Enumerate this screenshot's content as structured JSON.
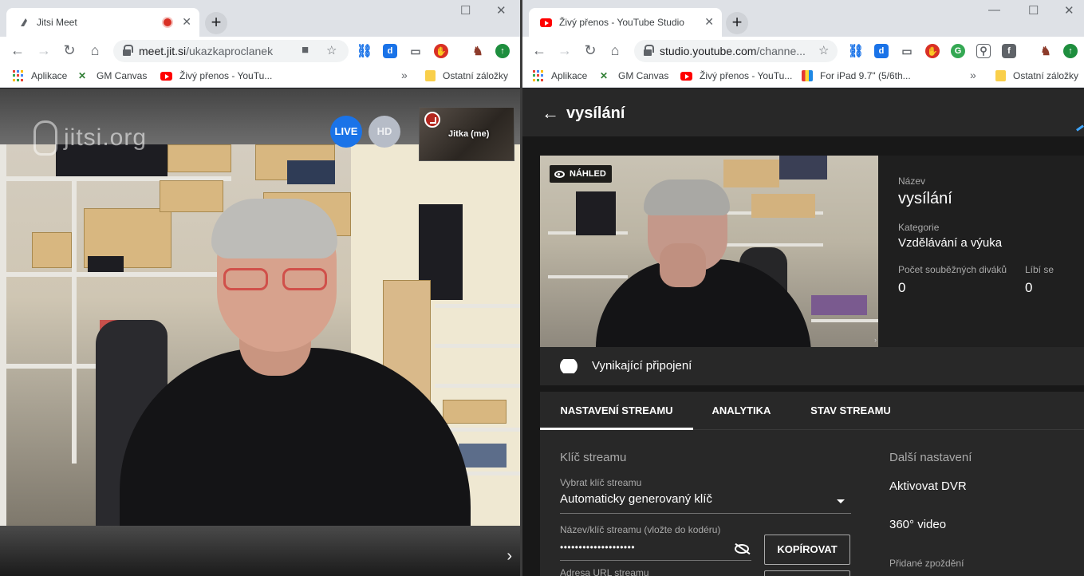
{
  "left_window": {
    "tab": {
      "title": "Jitsi Meet"
    },
    "url": {
      "host": "meet.jit.si",
      "path": "/ukazkaproclanek"
    },
    "bookmarks": [
      "Aplikace",
      "GM Canvas",
      "Živý přenos - YouTu..."
    ],
    "bookmarks_more": "»",
    "other_bookmarks": "Ostatní záložky",
    "jitsi": {
      "logo_text": "jitsi.org",
      "live_label": "LIVE",
      "hd_label": "HD",
      "thumbnail_name": "Jitka (me)"
    }
  },
  "right_window": {
    "tab": {
      "title": "Živý přenos - YouTube Studio"
    },
    "url": {
      "host": "studio.youtube.com",
      "path": "/channe..."
    },
    "bookmarks": [
      "Aplikace",
      "GM Canvas",
      "Živý přenos - YouTu...",
      "For iPad 9.7\" (5/6th..."
    ],
    "bookmarks_more": "»",
    "other_bookmarks": "Ostatní záložky",
    "studio": {
      "header_title": "vysílání",
      "preview_badge": "NÁHLED",
      "info": {
        "name_label": "Název",
        "name_value": "vysílání",
        "category_label": "Kategorie",
        "category_value": "Vzdělávání a výuka",
        "viewers_label": "Počet souběžných diváků",
        "viewers_value": "0",
        "likes_label": "Líbí se",
        "likes_value": "0"
      },
      "connection": "Vynikající připojení",
      "tabs": [
        "NASTAVENÍ STREAMU",
        "ANALYTIKA",
        "STAV STREAMU"
      ],
      "stream_key": {
        "section_title": "Klíč streamu",
        "select_label": "Vybrat klíč streamu",
        "select_value": "Automaticky generovaný klíč",
        "key_label": "Název/klíč streamu (vložte do kodéru)",
        "key_value": "••••••••••••••••••••",
        "copy_button": "KOPÍROVAT",
        "url_label": "Adresa URL streamu"
      },
      "more_settings": {
        "section_title": "Další nastavení",
        "dvr": "Aktivovat DVR",
        "video360": "360° video",
        "delay_label": "Přidané zpoždění"
      }
    }
  },
  "colors": {
    "jitsi_live": "#1a73e8",
    "jitsi_hd": "#b6bcc7",
    "studio_bg": "#181818",
    "studio_panel": "#282828",
    "youtube_red": "#ff0000",
    "recording_dot": "#d93025"
  },
  "icons": {
    "back": "back-arrow-icon",
    "wifi": "wifi-icon",
    "eye": "eye-icon",
    "eye_off": "eye-off-icon",
    "dropdown": "dropdown-arrow-icon"
  }
}
